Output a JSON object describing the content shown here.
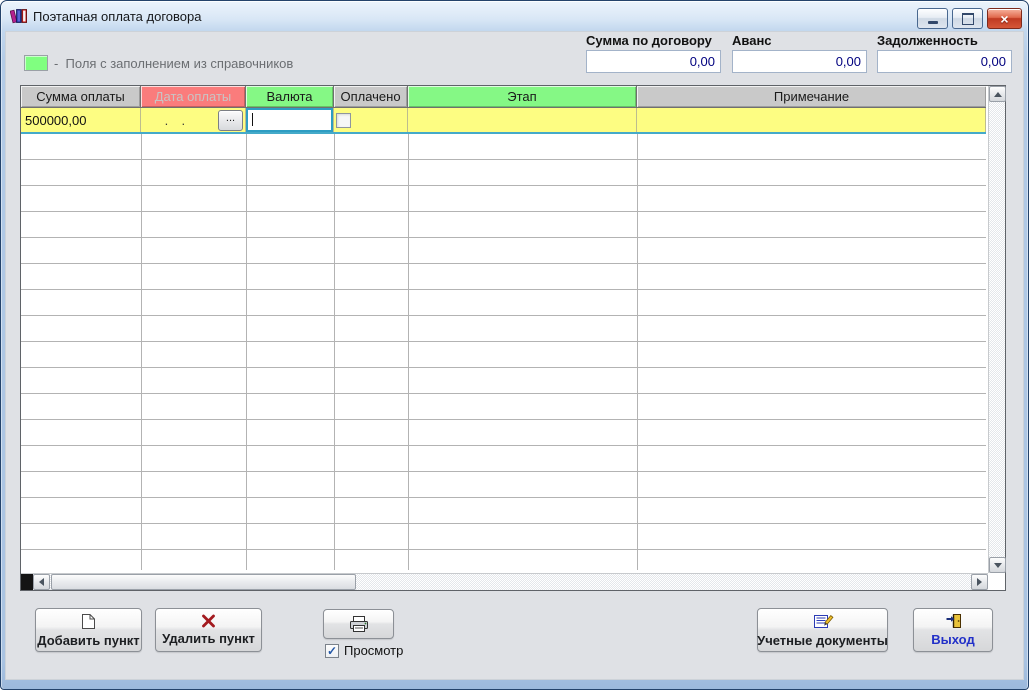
{
  "window": {
    "title": "Поэтапная оплата договора",
    "icon": "books-icon",
    "controls": [
      "minimize",
      "maximize",
      "close"
    ]
  },
  "legend": {
    "label": "-  Поля с заполнением из справочников",
    "swatch_color": "#80ff80"
  },
  "summary": {
    "fields": [
      {
        "label": "Сумма по договору",
        "value": "0,00"
      },
      {
        "label": "Аванс",
        "value": "0,00"
      },
      {
        "label": "Задолженность",
        "value": "0,00"
      }
    ]
  },
  "grid": {
    "headers": [
      "Сумма оплаты",
      "Дата оплаты",
      "Валюта",
      "Оплачено",
      "Этап",
      "Примечание"
    ],
    "header_colors": {
      "gray": "#c9c9c9",
      "required_red": "#fa7c7c",
      "reference_green": "#85f885"
    },
    "row1": {
      "amount": "500000,00",
      "date_mask": " .  .",
      "date_picker_label": "...",
      "currency_value": "",
      "paid_checked": false,
      "stage": "",
      "note": "",
      "row_color": "#fdfd82",
      "focus_border_color": "#2e9dc3"
    }
  },
  "toolbar": {
    "add_label": "Добавить пункт",
    "delete_label": "Удалить пункт",
    "preview_label": "Просмотр",
    "preview_checked": true,
    "check_glyph": "✓",
    "documents_label": "Учетные документы",
    "exit_label": "Выход"
  },
  "icons": {
    "title": "books-icon",
    "add": "new-document-icon",
    "delete": "red-cross-icon",
    "print": "printer-icon",
    "documents": "ledger-pencil-icon",
    "exit": "exit-door-icon"
  },
  "values_color": "#00007f"
}
